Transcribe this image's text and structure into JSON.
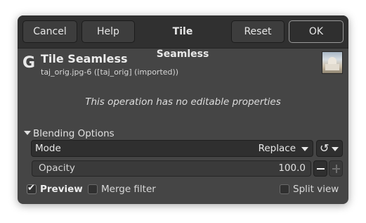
{
  "header": {
    "cancel_label": "Cancel",
    "help_label": "Help",
    "title": "Tile Seamless",
    "reset_label": "Reset",
    "ok_label": "OK"
  },
  "operation": {
    "icon": "gimp-g-icon",
    "title": "Tile Seamless",
    "subtitle": "taj_orig.jpg-6 ([taj_orig] (imported))",
    "no_properties_message": "This operation has no editable properties"
  },
  "blending": {
    "section_label": "Blending Options",
    "mode_label": "Mode",
    "mode_value": "Replace",
    "opacity_label": "Opacity",
    "opacity_value": "100.0"
  },
  "footer": {
    "preview_label": "Preview",
    "preview_checked": true,
    "merge_filter_label": "Merge filter",
    "merge_filter_checked": false,
    "split_view_label": "Split view",
    "split_view_checked": false
  },
  "colors": {
    "dialog_bg": "#454545",
    "header_bg": "#303030"
  }
}
